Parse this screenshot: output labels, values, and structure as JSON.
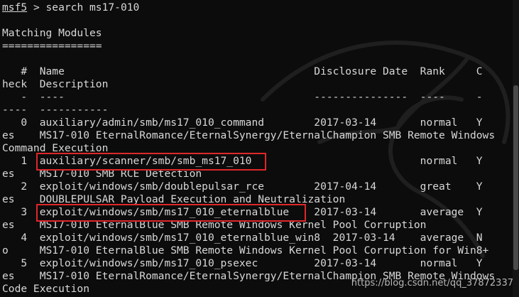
{
  "terminal": {
    "prompt": {
      "name": "msf5",
      "symbol": " > ",
      "command": "search ms17-010"
    },
    "lines": [
      "Matching Modules",
      "================",
      "",
      "   #  Name                                        Disclosure Date  Rank     C",
      "heck  Description",
      "   -  ----                                        ---------------  ----     -",
      "----  -----------",
      "   0  auxiliary/admin/smb/ms17_010_command        2017-03-14       normal   Y",
      "es    MS17-010 EternalRomance/EternalSynergy/EternalChampion SMB Remote Windows",
      "Command Execution",
      "   1  auxiliary/scanner/smb/smb_ms17_010                           normal   Y",
      "es    MS17-010 SMB RCE Detection",
      "   2  exploit/windows/smb/doublepulsar_rce        2017-04-14       great    Y",
      "es    DOUBLEPULSAR Payload Execution and Neutralization",
      "   3  exploit/windows/smb/ms17_010_eternalblue    2017-03-14       average  Y",
      "es    MS17-010 EternalBlue SMB Remote Windows Kernel Pool Corruption",
      "   4  exploit/windows/smb/ms17_010_eternalblue_win8  2017-03-14    average  N",
      "o     MS17-010 EternalBlue SMB Remote Windows Kernel Pool Corruption for Win8+",
      "   5  exploit/windows/smb/ms17_010_psexec         2017-03-14       normal   Y",
      "es    MS17-010 EternalRomance/EternalSynergy/EternalChampion SMB Remote Windows",
      "Code Execution"
    ],
    "highlighted_modules": [
      "auxiliary/scanner/smb/smb_ms17_010",
      "exploit/windows/smb/ms17_010_eternalblue"
    ]
  },
  "watermark": "https://blog.csdn.net/qq_37872337",
  "colors": {
    "background": "#0c0c0c",
    "text": "#d8d8d8",
    "highlight_box": "#e0262a"
  }
}
